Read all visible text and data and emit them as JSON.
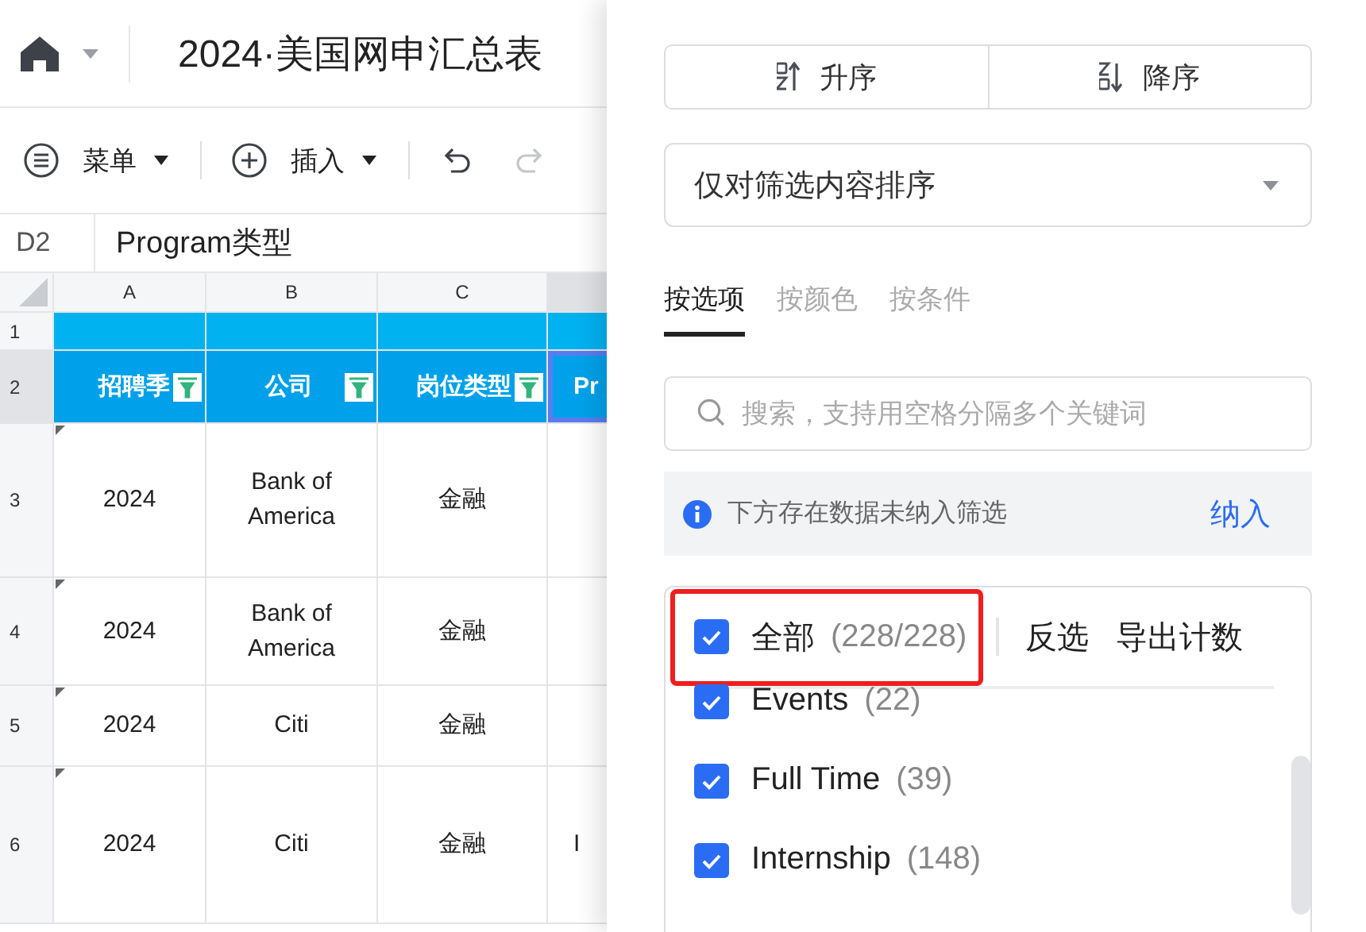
{
  "title_bar": {
    "title": "2024·美国网申汇总表"
  },
  "toolbar": [
    {
      "kind": "menu",
      "label": "菜单"
    },
    {
      "kind": "insert",
      "label": "插入"
    },
    {
      "kind": "undo",
      "disabled": false
    },
    {
      "kind": "redo",
      "disabled": true
    }
  ],
  "formula_bar": {
    "cell": "D2",
    "value": "Program类型"
  },
  "column_headers": [
    {
      "label": "A",
      "selected": false
    },
    {
      "label": "B",
      "selected": false
    },
    {
      "label": "C",
      "selected": false
    },
    {
      "selected": true
    }
  ],
  "rows": [
    {
      "number": "1",
      "kind": "band",
      "selected": false
    },
    {
      "number": "2",
      "kind": "header",
      "selected": true,
      "cells": [
        {
          "text": "招聘季",
          "filter": true
        },
        {
          "text": "公司",
          "filter": true
        },
        {
          "text": "岗位类型",
          "filter": true
        }
      ],
      "column_4": {
        "text": "Pr",
        "selected": true
      }
    },
    {
      "number": "3",
      "kind": "data",
      "selected": false,
      "comment": true,
      "cells": [
        {
          "text": "2024"
        },
        {
          "text": "Bank of America"
        },
        {
          "text": "金融"
        }
      ]
    },
    {
      "number": "4",
      "kind": "data",
      "selected": false,
      "comment": true,
      "cells": [
        {
          "text": "2024"
        },
        {
          "text": "Bank of America"
        },
        {
          "text": "金融"
        }
      ]
    },
    {
      "number": "5",
      "kind": "data",
      "selected": false,
      "comment": true,
      "cells": [
        {
          "text": "2024"
        },
        {
          "text": "Citi"
        },
        {
          "text": "金融"
        }
      ]
    },
    {
      "number": "6",
      "kind": "data",
      "selected": false,
      "comment": true,
      "cells": [
        {
          "text": "2024"
        },
        {
          "text": "Citi"
        },
        {
          "text": "金融"
        }
      ],
      "column_4": {
        "text": "I",
        "selected": false
      }
    }
  ],
  "filter_panel": {
    "sort_buttons": [
      {
        "kind": "ascending",
        "label": "升序"
      },
      {
        "kind": "descending",
        "label": "降序"
      }
    ],
    "scope_dropdown": {
      "value": "仅对筛选内容排序"
    },
    "tabs": [
      {
        "label": "按选项",
        "selected": true
      },
      {
        "label": "按颜色",
        "selected": false
      },
      {
        "label": "按条件",
        "selected": false
      }
    ],
    "search": {
      "placeholder": "搜索，支持用空格分隔多个关键词"
    },
    "notice": {
      "text": "下方存在数据未纳入筛选",
      "action": "纳入"
    },
    "select_all": {
      "label": "全部",
      "count": "(228/228)",
      "checked": true,
      "highlighted": true
    },
    "list_actions": [
      "反选",
      "导出计数"
    ],
    "options": [
      {
        "label": "Events",
        "count": "(22)",
        "checked": true
      },
      {
        "label": "Full Time",
        "count": "(39)",
        "checked": true
      },
      {
        "label": "Internship",
        "count": "(148)",
        "checked": true
      }
    ]
  }
}
